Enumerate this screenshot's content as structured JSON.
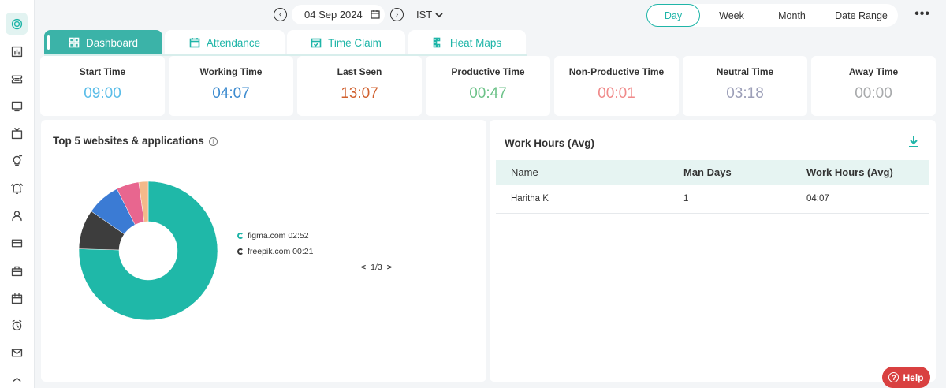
{
  "sidebar": {
    "icons": [
      "logo-icon",
      "reports-icon",
      "ticket-icon",
      "monitor-icon",
      "tv-icon",
      "bulb-icon",
      "alarm-bell-icon",
      "user-icon",
      "card-icon",
      "briefcase-icon",
      "calendar-icon",
      "clock-icon",
      "mail-icon",
      "chevron-up-icon"
    ]
  },
  "topbar": {
    "prev_icon": "‹",
    "next_icon": "›",
    "date": "04 Sep 2024",
    "timezone": "IST",
    "ranges": [
      "Day",
      "Week",
      "Month",
      "Date Range"
    ],
    "active_range": "Day",
    "more": "•••"
  },
  "tabs": [
    {
      "label": "Dashboard",
      "icon": "dashboard-icon",
      "active": true
    },
    {
      "label": "Attendance",
      "icon": "calendar-icon",
      "active": false
    },
    {
      "label": "Time Claim",
      "icon": "calendar-check-icon",
      "active": false
    },
    {
      "label": "Heat Maps",
      "icon": "heatmap-icon",
      "active": false
    }
  ],
  "stats": [
    {
      "label": "Start Time",
      "value": "09:00",
      "color": "#5bbde8"
    },
    {
      "label": "Working Time",
      "value": "04:07",
      "color": "#3d8bcf"
    },
    {
      "label": "Last Seen",
      "value": "13:07",
      "color": "#d0602e"
    },
    {
      "label": "Productive Time",
      "value": "00:47",
      "color": "#6dc289"
    },
    {
      "label": "Non-Productive Time",
      "value": "00:01",
      "color": "#f08a8a"
    },
    {
      "label": "Neutral Time",
      "value": "03:18",
      "color": "#9c9fb8"
    },
    {
      "label": "Away Time",
      "value": "00:00",
      "color": "#a8aaac"
    }
  ],
  "top_apps": {
    "title": "Top 5 websites & applications",
    "legend": [
      {
        "label": "figma.com 02:52",
        "color": "#1fb5a8"
      },
      {
        "label": "freepik.com 00:21",
        "color": "#3a3a3a"
      }
    ],
    "pager": {
      "prev": "<",
      "page": "1/3",
      "next": ">"
    },
    "chart_data": {
      "type": "pie",
      "categories": [
        "figma.com",
        "freepik.com",
        "",
        "",
        ""
      ],
      "values": [
        172,
        21,
        18,
        12,
        5
      ],
      "colors": [
        "#1fb8a8",
        "#3d3d3d",
        "#3b7bd4",
        "#e8668f",
        "#f4b98a"
      ]
    }
  },
  "work_hours": {
    "title": "Work Hours (Avg)",
    "columns": [
      "Name",
      "Man Days",
      "Work Hours (Avg)"
    ],
    "rows": [
      [
        "Haritha K",
        "1",
        "04:07"
      ]
    ]
  },
  "help": {
    "label": "Help",
    "icon": "?"
  }
}
